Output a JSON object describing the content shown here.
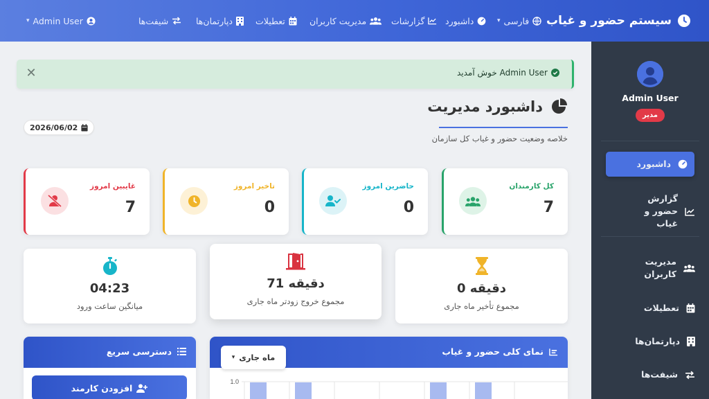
{
  "topbar": {
    "brand": "سیستم حضور و غیاب",
    "nav": {
      "language": "فارسی",
      "dashboard": "داشبورد",
      "reports": "گزارشات",
      "users": "مدیریت کاربران",
      "holidays": "تعطیلات",
      "departments": "دپارتمان‌ها",
      "shifts": "شیفت‌ها",
      "user_menu": "Admin User"
    }
  },
  "sidebar": {
    "user_name": "Admin User",
    "role": "مدیر",
    "items": [
      {
        "label": "داشبورد"
      },
      {
        "label": "گزارش حضور و غیاب"
      },
      {
        "label": "مدیریت کاربران"
      },
      {
        "label": "تعطیلات"
      },
      {
        "label": "دپارتمان‌ها"
      },
      {
        "label": "شیفت‌ها"
      }
    ]
  },
  "alert": {
    "message": "خوش آمدید Admin User"
  },
  "header": {
    "title": "داشبورد مدیریت",
    "subtitle": "خلاصه وضعیت حضور و غیاب کل سازمان",
    "date": "2026/06/02"
  },
  "stats": [
    {
      "label": "کل کارمندان",
      "value": "7",
      "color": "#28a36a"
    },
    {
      "label": "حاضرین امروز",
      "value": "0",
      "color": "#17b5c9"
    },
    {
      "label": "تاخیر امروز",
      "value": "0",
      "color": "#f0b429"
    },
    {
      "label": "غایبین امروز",
      "value": "7",
      "color": "#e23a48"
    }
  ],
  "summary": [
    {
      "value": "0 دقیقه",
      "caption": "مجموع تأخیر ماه جاری"
    },
    {
      "value": "71 دقیقه",
      "caption": "مجموع خروج زودتر ماه جاری"
    },
    {
      "value": "04:23",
      "caption": "میانگین ساعت ورود"
    }
  ],
  "chart_panel": {
    "title": "نمای کلی حضور و غیاب",
    "filter": "ماه جاری",
    "y_first_tick": "1.0"
  },
  "quick_panel": {
    "title": "دسترسی سریع",
    "add_employee": "افزودن کارمند"
  }
}
